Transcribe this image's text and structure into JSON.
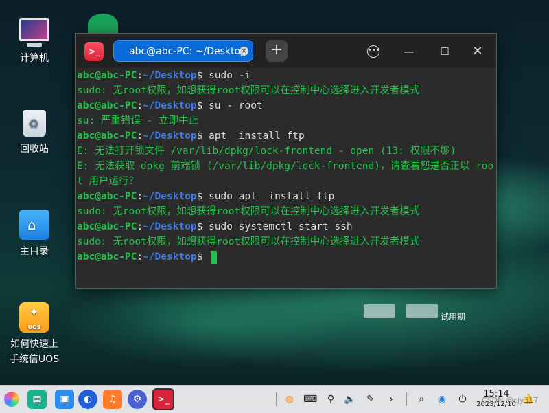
{
  "desktop": {
    "icons": [
      {
        "label": "计算机",
        "icon": "computer-icon"
      },
      {
        "label": "回收站",
        "icon": "trash-icon"
      },
      {
        "label": "主目录",
        "icon": "home-folder-icon"
      },
      {
        "label": "如何快速上\n手统信UOS",
        "icon": "uos-guide-icon",
        "badge": "UOS"
      }
    ],
    "trial_text": "试用期"
  },
  "terminal": {
    "app_icon": ">_",
    "tab_title": "abc@abc-PC: ~/Desktop",
    "tab_close": "×",
    "new_tab": "+",
    "menu_icon": "•••",
    "minimize": "—",
    "maximize": "☐",
    "close": "✕",
    "prompt_user": "abc@abc-PC",
    "prompt_sep": ":",
    "prompt_path": "~/Desktop",
    "prompt_sym": "$",
    "lines": [
      {
        "type": "cmd",
        "text": " sudo -i"
      },
      {
        "type": "out",
        "text": "sudo: 无root权限，如想获得root权限可以在控制中心选择进入开发者模式"
      },
      {
        "type": "cmd",
        "text": " su - root"
      },
      {
        "type": "out",
        "text": "su: 严重错误 - 立即中止"
      },
      {
        "type": "cmd",
        "text": " apt  install ftp"
      },
      {
        "type": "out",
        "text": "E: 无法打开锁文件 /var/lib/dpkg/lock-frontend - open (13: 权限不够)"
      },
      {
        "type": "out",
        "text": "E: 无法获取 dpkg 前端锁 (/var/lib/dpkg/lock-frontend)，请查看您是否正以 root 用户运行？"
      },
      {
        "type": "cmd",
        "text": " sudo apt  install ftp"
      },
      {
        "type": "out",
        "text": "sudo: 无root权限，如想获得root权限可以在控制中心选择进入开发者模式"
      },
      {
        "type": "cmd",
        "text": " sudo systemctl start ssh"
      },
      {
        "type": "out",
        "text": "sudo: 无root权限，如想获得root权限可以在控制中心选择进入开发者模式"
      },
      {
        "type": "prompt",
        "text": " "
      }
    ]
  },
  "taskbar": {
    "launcher": "launcher-icon",
    "apps": [
      "multitasking-view-icon",
      "app-store-icon",
      "browser-icon",
      "music-icon",
      "settings-icon",
      "terminal-icon"
    ],
    "tray": [
      "input-method-icon",
      "keyboard-icon",
      "usb-icon",
      "volume-icon",
      "pen-icon",
      "expand-icon",
      "search-icon",
      "network-icon",
      "power-icon"
    ],
    "time": "15:14",
    "date": "2023/12/10",
    "notification": "bell-icon"
  },
  "watermark": "CSDN @cjy317",
  "colors": {
    "prompt_green": "#21c34a",
    "path_blue": "#3e7be8",
    "tab_blue": "#0a6ad8",
    "terminal_bg": "#2b2b2b"
  }
}
